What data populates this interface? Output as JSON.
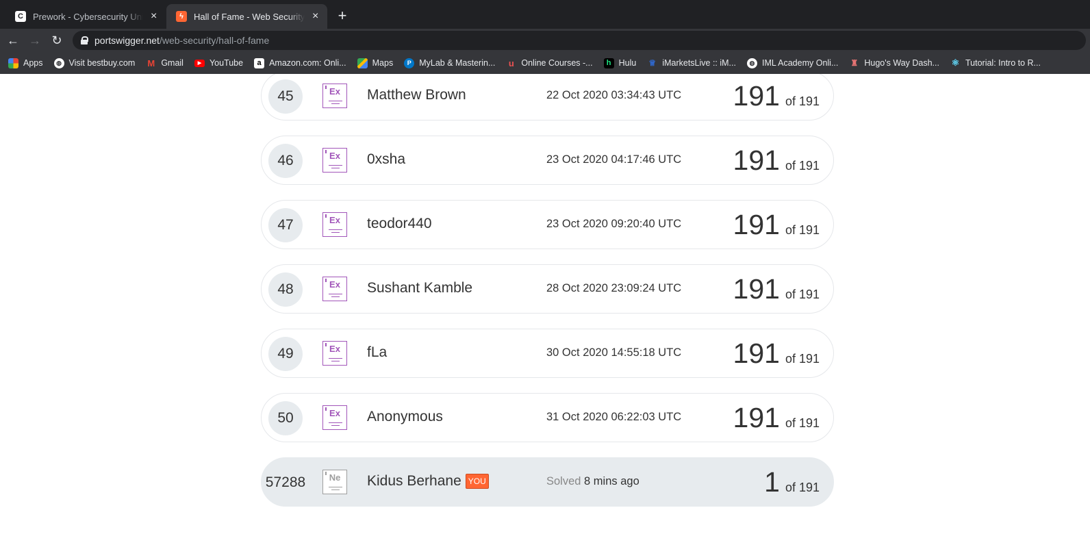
{
  "browser": {
    "tabs": [
      {
        "title": "Prework - Cybersecurity University",
        "favicon": "C",
        "active": false
      },
      {
        "title": "Hall of Fame - Web Security Academy",
        "favicon": "ϟ",
        "active": true
      }
    ],
    "url_host": "portswigger.net",
    "url_path": "/web-security/hall-of-fame",
    "bookmarks": [
      {
        "label": "Apps",
        "icon": "apps-grid-icon",
        "color": "#ea4335"
      },
      {
        "label": "Visit bestbuy.com",
        "icon": "globe-icon",
        "color": "#ffffff"
      },
      {
        "label": "Gmail",
        "icon": "gmail-icon",
        "color": "#ea4335"
      },
      {
        "label": "YouTube",
        "icon": "youtube-icon",
        "color": "#ff0000"
      },
      {
        "label": "Amazon.com: Onli...",
        "icon": "amazon-icon",
        "color": "#ffffff"
      },
      {
        "label": "Maps",
        "icon": "maps-icon",
        "color": "#34a853"
      },
      {
        "label": "MyLab & Masterin...",
        "icon": "pearson-icon",
        "color": "#0077c8"
      },
      {
        "label": "Online Courses -...",
        "icon": "udemy-icon",
        "color": "#ec5252"
      },
      {
        "label": "Hulu",
        "icon": "hulu-icon",
        "color": "#1ce783"
      },
      {
        "label": "iMarketsLive :: iM...",
        "icon": "imarkets-icon",
        "color": "#2f6bd6"
      },
      {
        "label": "IML Academy Onli...",
        "icon": "globe-icon",
        "color": "#ffffff"
      },
      {
        "label": "Hugo's Way Dash...",
        "icon": "hugo-icon",
        "color": "#e57373"
      },
      {
        "label": "Tutorial: Intro to R...",
        "icon": "react-icon",
        "color": "#61dafb"
      }
    ]
  },
  "hall_of_fame": {
    "rows": [
      {
        "rank": "45",
        "level": "Ex",
        "name": "Matthew Brown",
        "date": "22 Oct 2020 03:34:43 UTC",
        "score": "191",
        "of": "of 191"
      },
      {
        "rank": "46",
        "level": "Ex",
        "name": "0xsha",
        "date": "23 Oct 2020 04:17:46 UTC",
        "score": "191",
        "of": "of 191"
      },
      {
        "rank": "47",
        "level": "Ex",
        "name": "teodor440",
        "date": "23 Oct 2020 09:20:40 UTC",
        "score": "191",
        "of": "of 191"
      },
      {
        "rank": "48",
        "level": "Ex",
        "name": "Sushant Kamble",
        "date": "28 Oct 2020 23:09:24 UTC",
        "score": "191",
        "of": "of 191"
      },
      {
        "rank": "49",
        "level": "Ex",
        "name": "fLa",
        "date": "30 Oct 2020 14:55:18 UTC",
        "score": "191",
        "of": "of 191"
      },
      {
        "rank": "50",
        "level": "Ex",
        "name": "Anonymous",
        "date": "31 Oct 2020 06:22:03 UTC",
        "score": "191",
        "of": "of 191"
      }
    ],
    "current_user": {
      "rank": "57288",
      "level": "Ne",
      "name": "Kidus Berhane",
      "badge": "YOU",
      "solved_prefix": "Solved",
      "solved_time": "8 mins ago",
      "score": "1",
      "of": "of 191"
    }
  }
}
